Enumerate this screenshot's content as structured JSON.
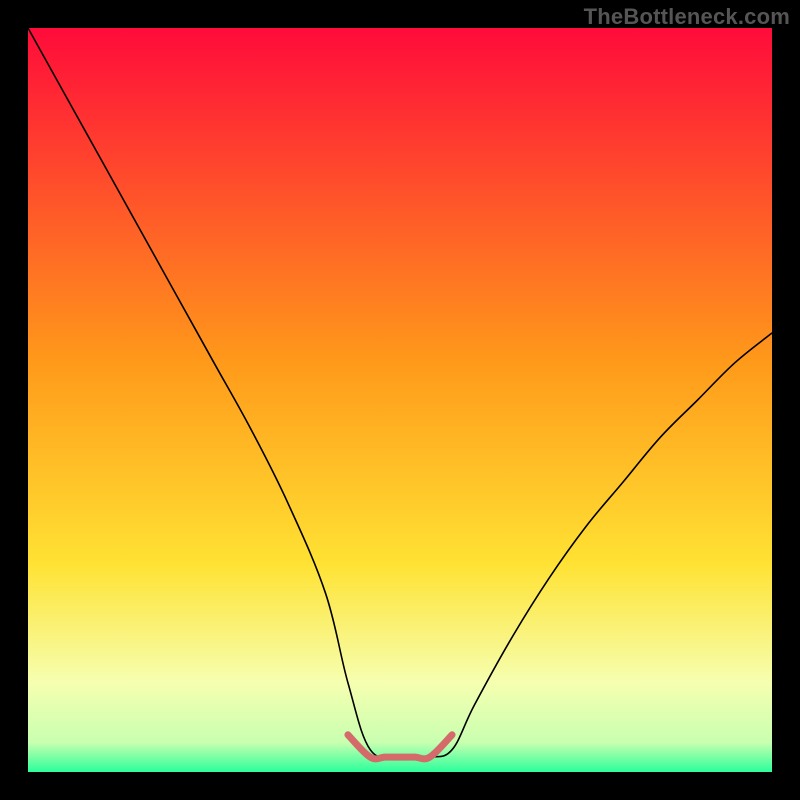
{
  "watermark": "TheBottleneck.com",
  "chart_data": {
    "type": "line",
    "title": "",
    "xlabel": "",
    "ylabel": "",
    "xlim": [
      0,
      100
    ],
    "ylim": [
      0,
      100
    ],
    "grid": false,
    "legend": false,
    "background_gradient": {
      "stops": [
        {
          "offset": 0.0,
          "color": "#ff0b3a"
        },
        {
          "offset": 0.45,
          "color": "#ff9a1a"
        },
        {
          "offset": 0.72,
          "color": "#ffe233"
        },
        {
          "offset": 0.88,
          "color": "#f6ffb0"
        },
        {
          "offset": 0.96,
          "color": "#c9ffb0"
        },
        {
          "offset": 1.0,
          "color": "#2bff9b"
        }
      ]
    },
    "series": [
      {
        "name": "bottleneck-curve",
        "color": "#000000",
        "width": 1.6,
        "x": [
          0,
          5,
          10,
          15,
          20,
          25,
          30,
          35,
          40,
          43,
          46,
          50,
          54,
          57,
          60,
          65,
          70,
          75,
          80,
          85,
          90,
          95,
          100
        ],
        "y": [
          100,
          91,
          82,
          73,
          64,
          55,
          46,
          36,
          24,
          12,
          3,
          2,
          2,
          3,
          9,
          18,
          26,
          33,
          39,
          45,
          50,
          55,
          59
        ]
      },
      {
        "name": "optimal-band",
        "color": "#d46a6a",
        "width": 7,
        "x": [
          43,
          46,
          48,
          50,
          52,
          54,
          57
        ],
        "y": [
          5,
          2,
          2,
          2,
          2,
          2,
          5
        ]
      }
    ]
  }
}
